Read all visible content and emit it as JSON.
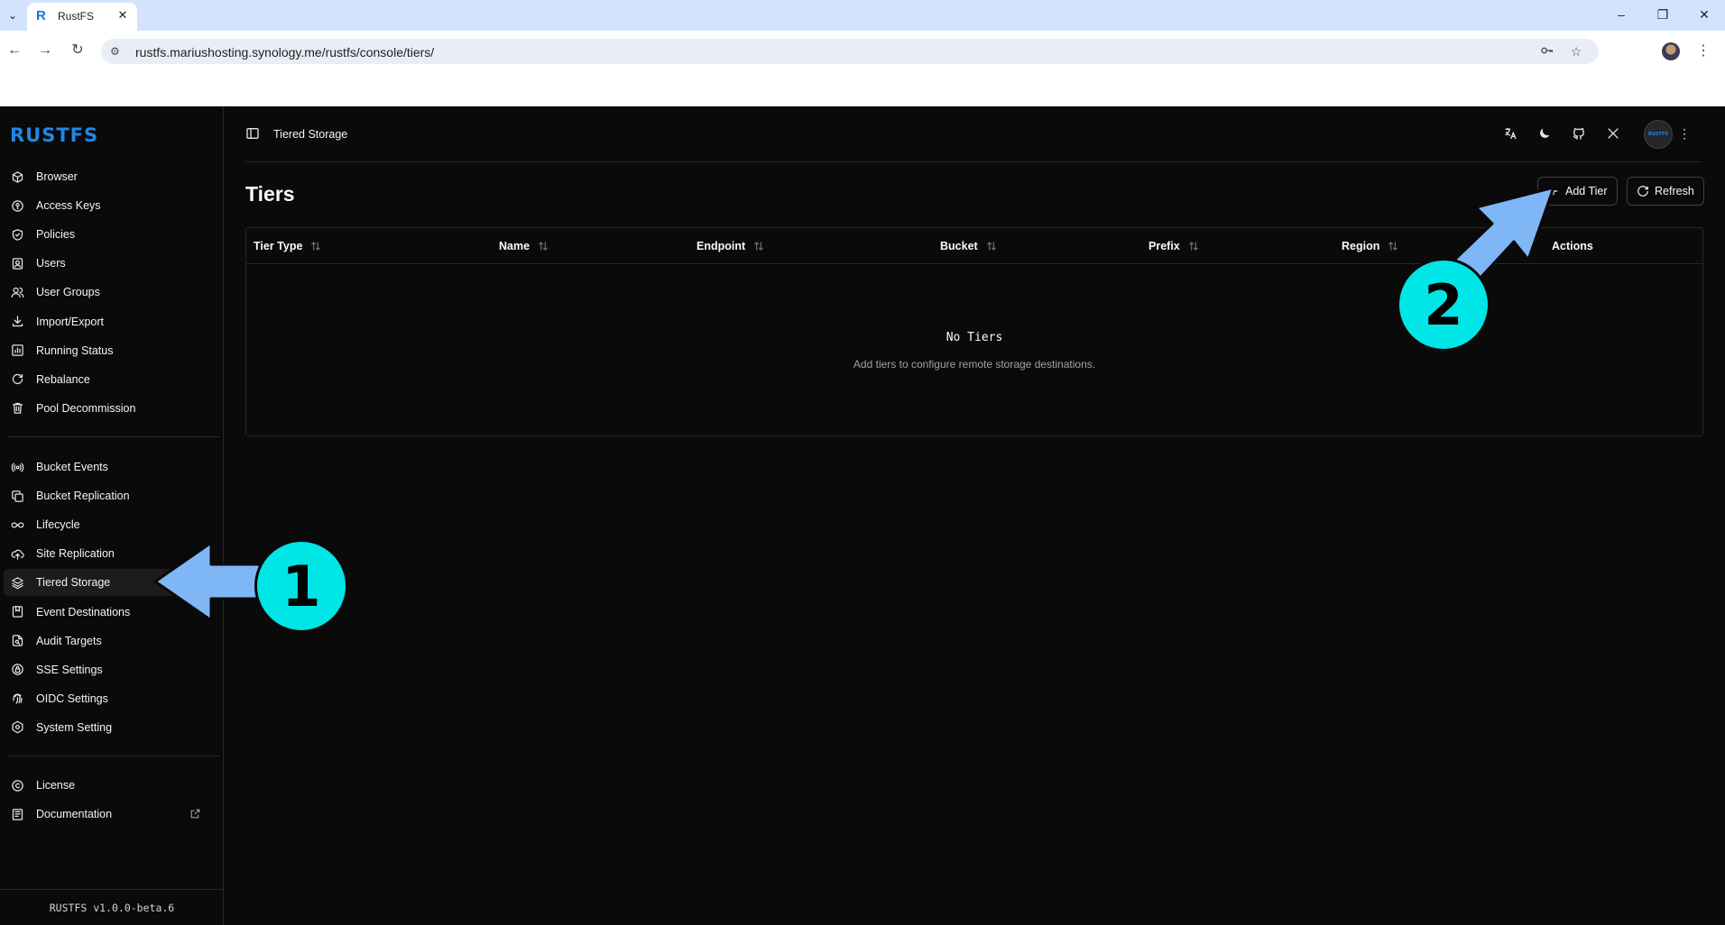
{
  "browser": {
    "tab_title": "RustFS",
    "url": "rustfs.mariushosting.synology.me/rustfs/console/tiers/"
  },
  "app": {
    "logo": "RUSTFS",
    "version": "RUSTFS  v1.0.0-beta.6"
  },
  "sidebar": {
    "group1": [
      {
        "label": "Browser",
        "icon": "cube-icon"
      },
      {
        "label": "Access Keys",
        "icon": "key-circle-icon"
      },
      {
        "label": "Policies",
        "icon": "shield-check-icon"
      },
      {
        "label": "Users",
        "icon": "user-card-icon"
      },
      {
        "label": "User Groups",
        "icon": "users-icon"
      },
      {
        "label": "Import/Export",
        "icon": "download-icon"
      },
      {
        "label": "Running Status",
        "icon": "chart-icon"
      },
      {
        "label": "Rebalance",
        "icon": "refresh-icon"
      },
      {
        "label": "Pool Decommission",
        "icon": "trash-icon"
      }
    ],
    "group2": [
      {
        "label": "Bucket Events",
        "icon": "broadcast-icon"
      },
      {
        "label": "Bucket Replication",
        "icon": "copy-icon"
      },
      {
        "label": "Lifecycle",
        "icon": "infinity-icon"
      },
      {
        "label": "Site Replication",
        "icon": "cloud-upload-icon"
      },
      {
        "label": "Tiered Storage",
        "icon": "layers-icon"
      },
      {
        "label": "Event Destinations",
        "icon": "bookmark-icon"
      },
      {
        "label": "Audit Targets",
        "icon": "file-search-icon"
      },
      {
        "label": "SSE Settings",
        "icon": "lock-icon"
      },
      {
        "label": "OIDC Settings",
        "icon": "fingerprint-icon"
      },
      {
        "label": "System Setting",
        "icon": "settings-icon"
      }
    ],
    "group3": [
      {
        "label": "License",
        "icon": "copyright-icon"
      },
      {
        "label": "Documentation",
        "icon": "book-icon"
      }
    ],
    "active": "Tiered Storage"
  },
  "topbar": {
    "breadcrumb": "Tiered Storage",
    "avatar_text": "RUSTFS"
  },
  "page": {
    "title": "Tiers",
    "add_button": "Add Tier",
    "refresh_button": "Refresh"
  },
  "table": {
    "columns": [
      "Tier Type",
      "Name",
      "Endpoint",
      "Bucket",
      "Prefix",
      "Region",
      "Actions"
    ],
    "empty_title": "No Tiers",
    "empty_subtitle": "Add tiers to configure remote storage destinations."
  },
  "annotations": {
    "badge1": "1",
    "badge2": "2",
    "accent": "#00e5e5",
    "arrow": "#7eb6f6"
  }
}
